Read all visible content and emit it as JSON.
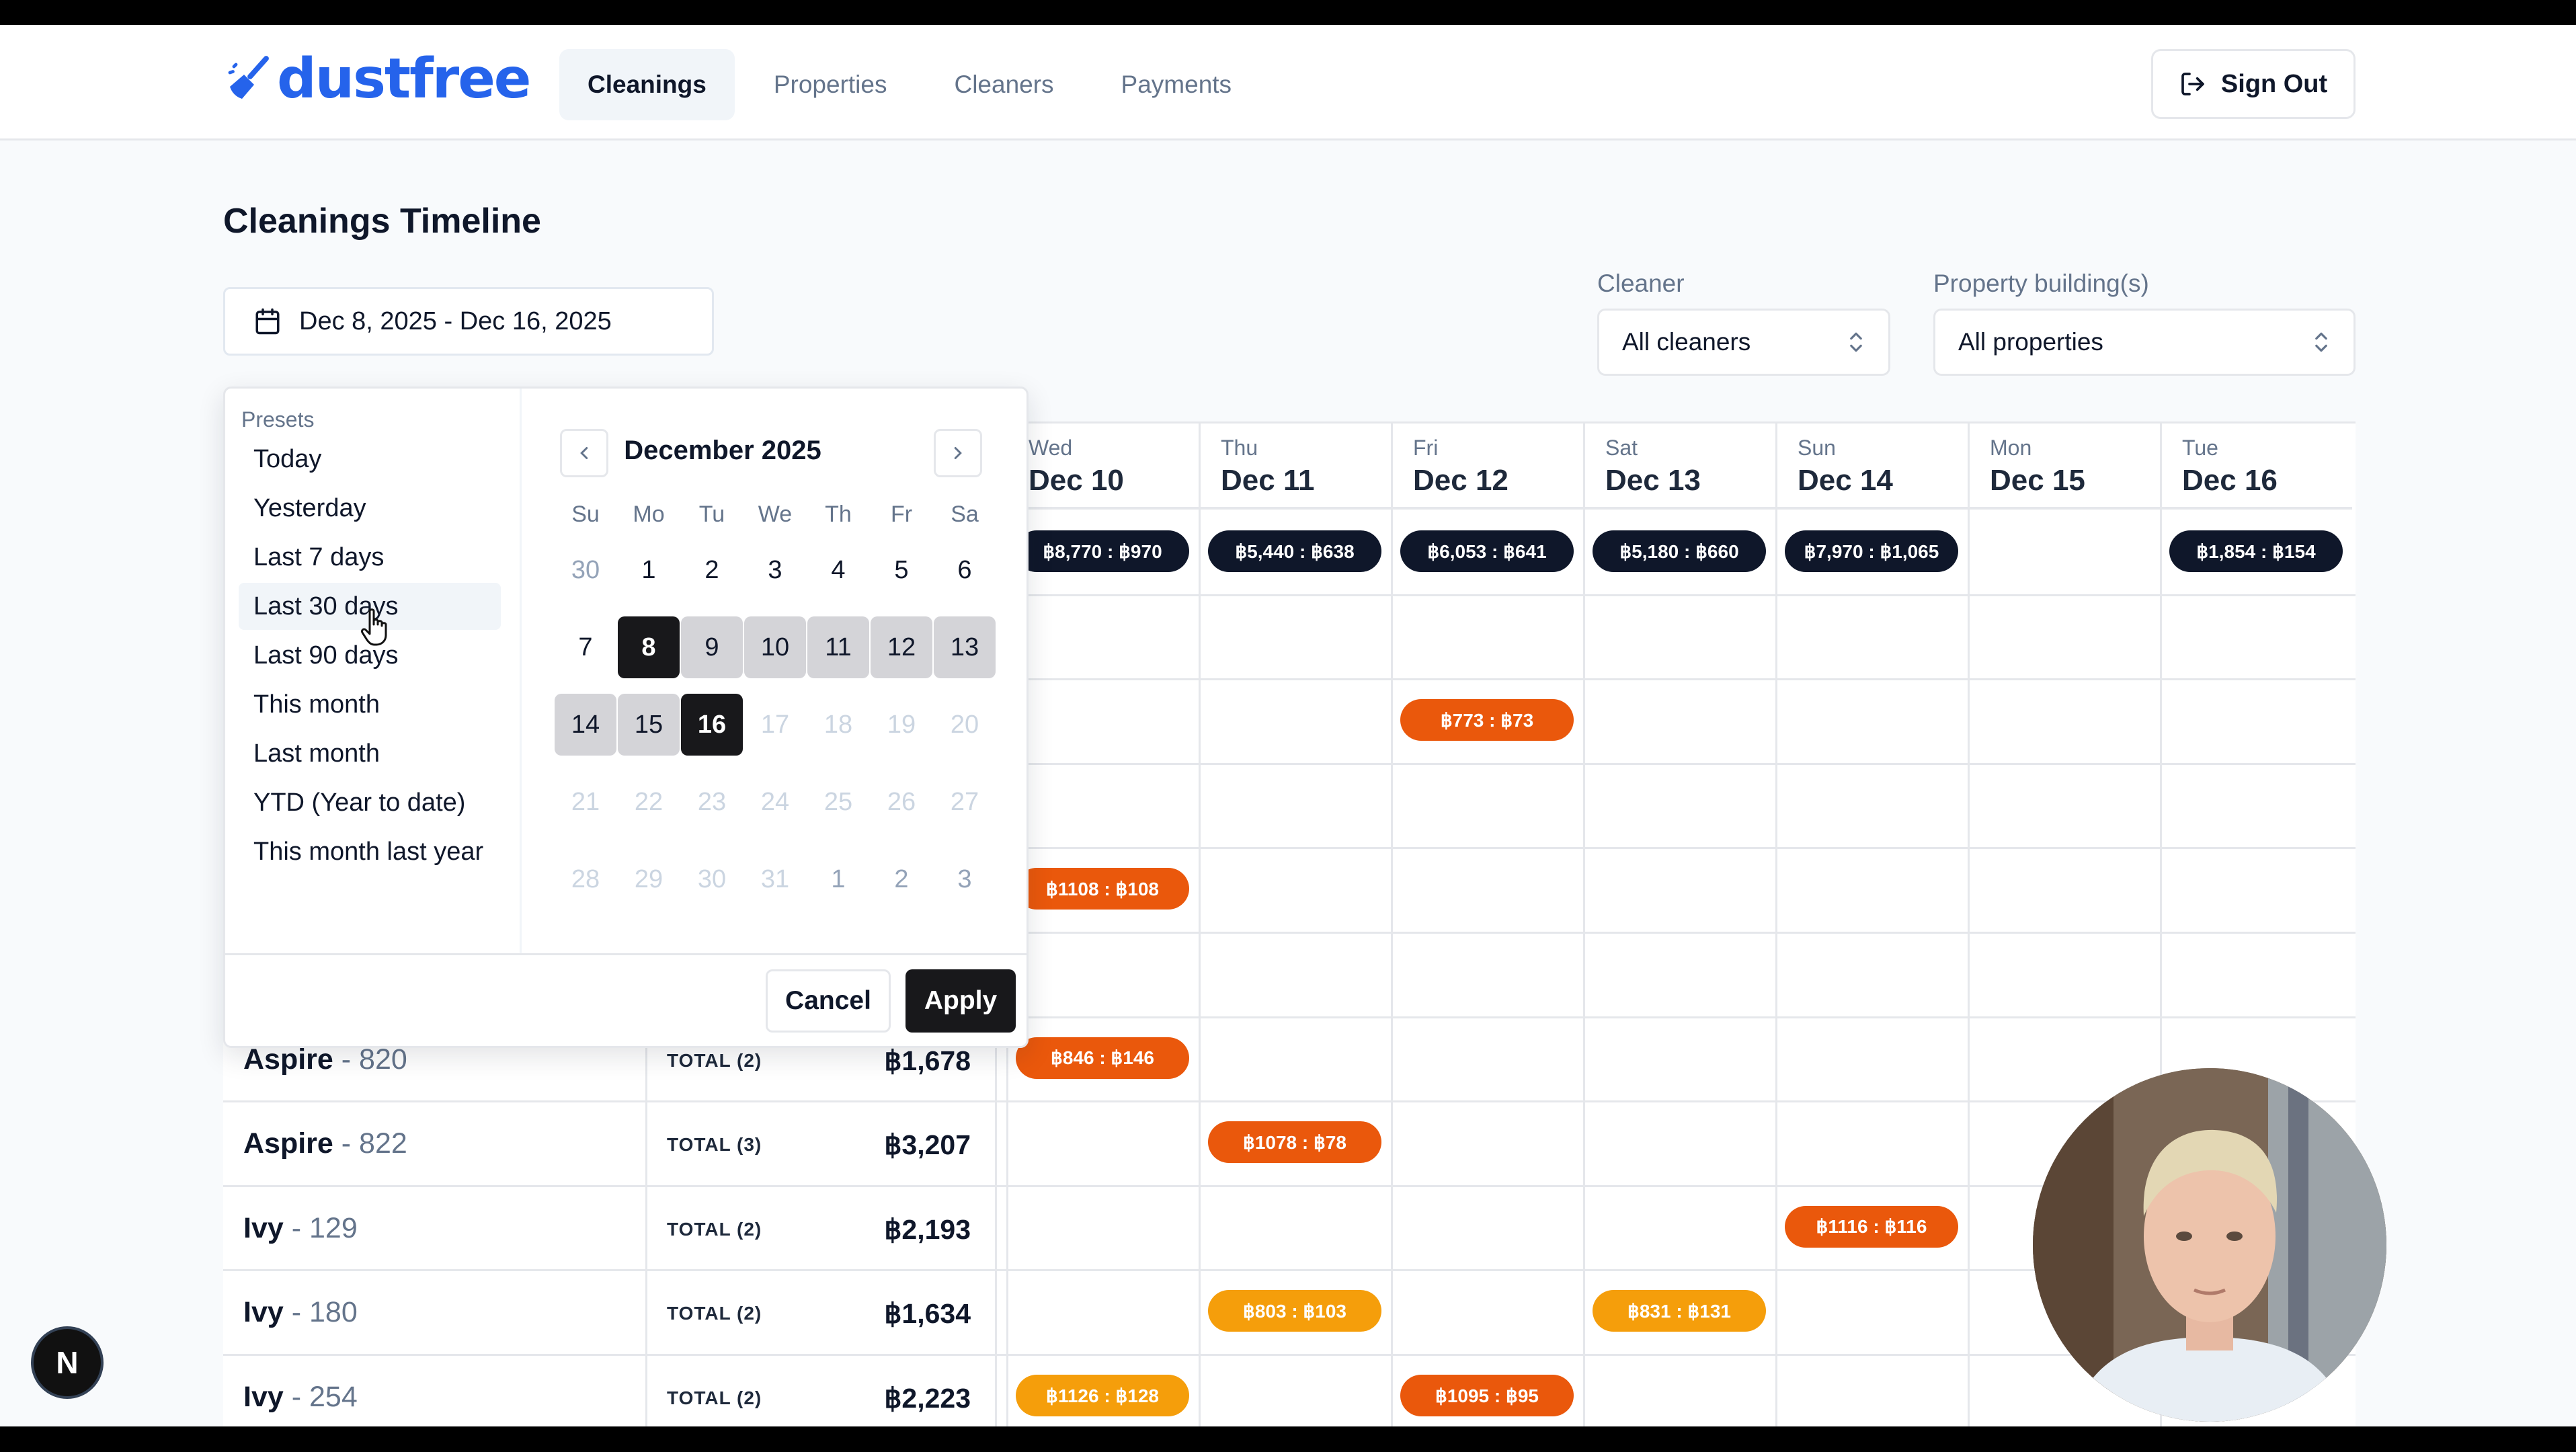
{
  "app": {
    "logo": "dustfree"
  },
  "nav": {
    "items": [
      "Cleanings",
      "Properties",
      "Cleaners",
      "Payments"
    ],
    "active": "Cleanings",
    "sign_out": "Sign Out"
  },
  "page": {
    "title": "Cleanings Timeline",
    "date_range": "Dec 8, 2025 - Dec 16, 2025"
  },
  "filters": {
    "cleaner_label": "Cleaner",
    "cleaner_value": "All cleaners",
    "property_label": "Property building(s)",
    "property_value": "All properties"
  },
  "timeline": {
    "days": [
      {
        "name": "Wed",
        "date": "Dec 10"
      },
      {
        "name": "Thu",
        "date": "Dec 11"
      },
      {
        "name": "Fri",
        "date": "Dec 12"
      },
      {
        "name": "Sat",
        "date": "Dec 13"
      },
      {
        "name": "Sun",
        "date": "Dec 14"
      },
      {
        "name": "Mon",
        "date": "Dec 15"
      },
      {
        "name": "Tue",
        "date": "Dec 16"
      }
    ],
    "daily_totals": [
      "฿8,770 : ฿970",
      "฿5,440 : ฿638",
      "฿6,053 : ฿641",
      "฿5,180 : ฿660",
      "฿7,970 : ฿1,065",
      "",
      "฿1,854 : ฿154"
    ],
    "pills": [
      {
        "row": 2,
        "day": 2,
        "text": "฿773 : ฿73",
        "color": "orange"
      },
      {
        "row": 4,
        "day": 0,
        "text": "฿1108 : ฿108",
        "color": "orange"
      },
      {
        "row": 6,
        "day": 0,
        "text": "฿846 : ฿146",
        "color": "orange"
      },
      {
        "row": 7,
        "day": 1,
        "text": "฿1078 : ฿78",
        "color": "orange"
      },
      {
        "row": 8,
        "day": 4,
        "text": "฿1116 : ฿116",
        "color": "orange"
      },
      {
        "row": 9,
        "day": 1,
        "text": "฿803 : ฿103",
        "color": "amber"
      },
      {
        "row": 9,
        "day": 3,
        "text": "฿831 : ฿131",
        "color": "amber"
      },
      {
        "row": 10,
        "day": 0,
        "text": "฿1126 : ฿128",
        "color": "amber"
      },
      {
        "row": 10,
        "day": 2,
        "text": "฿1095 : ฿95",
        "color": "orange"
      }
    ],
    "properties": [
      {
        "building": "Aspire",
        "unit": "820",
        "total_label": "TOTAL (2)",
        "amount": "฿1,678"
      },
      {
        "building": "Aspire",
        "unit": "822",
        "total_label": "TOTAL (3)",
        "amount": "฿3,207"
      },
      {
        "building": "Ivy",
        "unit": "129",
        "total_label": "TOTAL (2)",
        "amount": "฿2,193"
      },
      {
        "building": "Ivy",
        "unit": "180",
        "total_label": "TOTAL (2)",
        "amount": "฿1,634"
      },
      {
        "building": "Ivy",
        "unit": "254",
        "total_label": "TOTAL (2)",
        "amount": "฿2,223"
      }
    ]
  },
  "datepicker": {
    "presets_title": "Presets",
    "presets": [
      "Today",
      "Yesterday",
      "Last 7 days",
      "Last 30 days",
      "Last 90 days",
      "This month",
      "Last month",
      "YTD (Year to date)",
      "This month last year"
    ],
    "hovered_preset": "Last 30 days",
    "month_title": "December 2025",
    "weekdays": [
      "Su",
      "Mo",
      "Tu",
      "We",
      "Th",
      "Fr",
      "Sa"
    ],
    "weeks": [
      [
        "30",
        "1",
        "2",
        "3",
        "4",
        "5",
        "6"
      ],
      [
        "7",
        "8",
        "9",
        "10",
        "11",
        "12",
        "13"
      ],
      [
        "14",
        "15",
        "16",
        "17",
        "18",
        "19",
        "20"
      ],
      [
        "21",
        "22",
        "23",
        "24",
        "25",
        "26",
        "27"
      ],
      [
        "28",
        "29",
        "30",
        "31",
        "1",
        "2",
        "3"
      ]
    ],
    "range_start": "8",
    "range_end": "16",
    "cancel": "Cancel",
    "apply": "Apply"
  },
  "dev_badge": "N"
}
